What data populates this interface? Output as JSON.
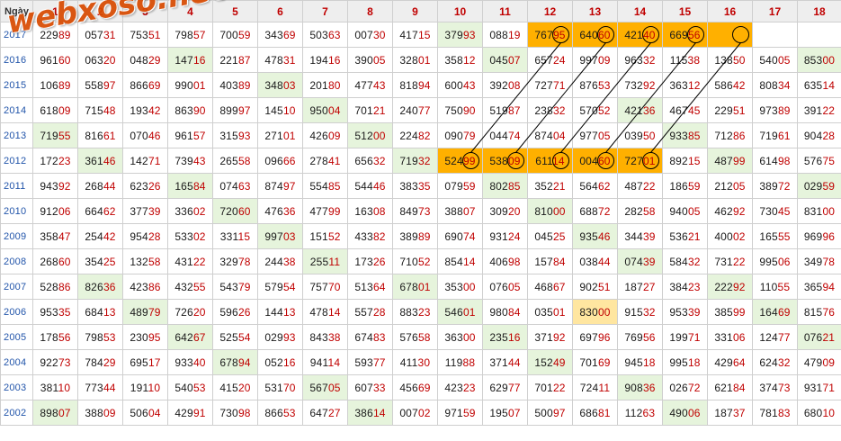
{
  "header": {
    "corner_label": "Ngày",
    "days": [
      "1",
      "2",
      "3",
      "4",
      "5",
      "6",
      "7",
      "8",
      "9",
      "10",
      "11",
      "12",
      "13",
      "14",
      "15",
      "16",
      "17",
      "18"
    ]
  },
  "logo": {
    "text": "webxoso.net"
  },
  "rows": [
    {
      "year": "2017",
      "cells": [
        "22989",
        "05731",
        "75351",
        "79857",
        "70059",
        "34369",
        "50363",
        "00730",
        "41715",
        "37993",
        "08819",
        "76795",
        "64060",
        "42140",
        "66956",
        "",
        "",
        ""
      ],
      "green": [
        9
      ],
      "orange": [
        11,
        12,
        13,
        14,
        15
      ],
      "yellow": []
    },
    {
      "year": "2016",
      "cells": [
        "96160",
        "06320",
        "04829",
        "14716",
        "22187",
        "47831",
        "19416",
        "39005",
        "32801",
        "35812",
        "04507",
        "65724",
        "99709",
        "96332",
        "11538",
        "13850",
        "54005",
        "85300"
      ],
      "green": [
        3,
        10,
        17
      ],
      "orange": [],
      "yellow": []
    },
    {
      "year": "2015",
      "cells": [
        "10689",
        "55897",
        "86669",
        "99001",
        "40389",
        "34803",
        "20180",
        "47743",
        "81894",
        "60043",
        "39208",
        "72771",
        "87653",
        "73292",
        "36312",
        "58642",
        "80834",
        "63514"
      ],
      "green": [
        5
      ],
      "orange": [],
      "yellow": []
    },
    {
      "year": "2014",
      "cells": [
        "61809",
        "71548",
        "19342",
        "86390",
        "89997",
        "14510",
        "95004",
        "70121",
        "24077",
        "75090",
        "51987",
        "23832",
        "57052",
        "42136",
        "46745",
        "22951",
        "97389",
        "39122"
      ],
      "green": [
        6,
        13
      ],
      "orange": [],
      "yellow": []
    },
    {
      "year": "2013",
      "cells": [
        "71955",
        "81661",
        "07046",
        "96157",
        "31593",
        "27101",
        "42609",
        "51200",
        "22482",
        "09079",
        "04474",
        "87404",
        "97705",
        "03950",
        "93385",
        "71286",
        "71961",
        "90428"
      ],
      "green": [
        0,
        7,
        14
      ],
      "orange": [],
      "yellow": []
    },
    {
      "year": "2012",
      "cells": [
        "17223",
        "36146",
        "14271",
        "73943",
        "26558",
        "09666",
        "27841",
        "65632",
        "71932",
        "52499",
        "53809",
        "61114",
        "00460",
        "72701",
        "89215",
        "48799",
        "61498",
        "57675"
      ],
      "green": [
        1,
        8,
        15
      ],
      "orange": [
        9,
        10,
        11,
        12,
        13
      ],
      "yellow": []
    },
    {
      "year": "2011",
      "cells": [
        "94392",
        "26844",
        "62326",
        "16584",
        "07463",
        "87497",
        "55485",
        "54446",
        "38335",
        "07959",
        "80285",
        "35221",
        "56462",
        "48722",
        "18659",
        "21205",
        "38972",
        "02959"
      ],
      "green": [
        3,
        10,
        17
      ],
      "orange": [],
      "yellow": []
    },
    {
      "year": "2010",
      "cells": [
        "91206",
        "66462",
        "37739",
        "33602",
        "72060",
        "47636",
        "47799",
        "16308",
        "84973",
        "38807",
        "30920",
        "81000",
        "68872",
        "28258",
        "94005",
        "46292",
        "73045",
        "83100"
      ],
      "green": [
        4,
        11
      ],
      "orange": [],
      "yellow": []
    },
    {
      "year": "2009",
      "cells": [
        "35847",
        "25442",
        "95428",
        "53302",
        "33115",
        "99703",
        "15152",
        "43382",
        "38989",
        "69074",
        "93124",
        "04525",
        "93546",
        "34439",
        "53621",
        "40002",
        "16555",
        "96996"
      ],
      "green": [
        5,
        12
      ],
      "orange": [],
      "yellow": []
    },
    {
      "year": "2008",
      "cells": [
        "26860",
        "35425",
        "13258",
        "43122",
        "32978",
        "24438",
        "25511",
        "17326",
        "71052",
        "85414",
        "40698",
        "15784",
        "03844",
        "07439",
        "58432",
        "73122",
        "99506",
        "34978"
      ],
      "green": [
        6,
        13
      ],
      "orange": [],
      "yellow": []
    },
    {
      "year": "2007",
      "cells": [
        "52886",
        "82636",
        "42386",
        "43255",
        "54379",
        "57954",
        "75770",
        "51364",
        "67801",
        "35300",
        "07605",
        "46867",
        "90251",
        "18727",
        "38423",
        "22292",
        "11055",
        "36594"
      ],
      "green": [
        1,
        8,
        15
      ],
      "orange": [],
      "yellow": []
    },
    {
      "year": "2006",
      "cells": [
        "95335",
        "68413",
        "48979",
        "72620",
        "59626",
        "14413",
        "47814",
        "55728",
        "88323",
        "54601",
        "98084",
        "03501",
        "83000",
        "91532",
        "95339",
        "38599",
        "16469",
        "81576"
      ],
      "green": [
        2,
        9,
        16
      ],
      "orange": [],
      "yellow": [
        12
      ]
    },
    {
      "year": "2005",
      "cells": [
        "17856",
        "79853",
        "23095",
        "64267",
        "52554",
        "02993",
        "84338",
        "67483",
        "57658",
        "36300",
        "23516",
        "37192",
        "69796",
        "76956",
        "19971",
        "33106",
        "12477",
        "07621"
      ],
      "green": [
        3,
        10,
        17
      ],
      "orange": [],
      "yellow": []
    },
    {
      "year": "2004",
      "cells": [
        "92273",
        "78429",
        "69517",
        "93340",
        "67894",
        "05216",
        "94114",
        "59377",
        "41130",
        "11988",
        "37144",
        "15249",
        "70169",
        "94518",
        "99518",
        "42964",
        "62432",
        "47909"
      ],
      "green": [
        4,
        11
      ],
      "orange": [],
      "yellow": []
    },
    {
      "year": "2003",
      "cells": [
        "38110",
        "77344",
        "19110",
        "54053",
        "41520",
        "53170",
        "56705",
        "60733",
        "45669",
        "42323",
        "62977",
        "70122",
        "72411",
        "90836",
        "02672",
        "62184",
        "37473",
        "93171"
      ],
      "green": [
        6,
        13
      ],
      "orange": [],
      "yellow": []
    },
    {
      "year": "2002",
      "cells": [
        "89807",
        "38809",
        "50604",
        "42991",
        "73098",
        "86653",
        "64727",
        "38614",
        "00702",
        "97159",
        "19507",
        "50097",
        "68681",
        "11263",
        "49006",
        "18737",
        "78183",
        "68010"
      ],
      "green": [
        0,
        7,
        14
      ],
      "orange": [],
      "yellow": []
    }
  ],
  "colors": {
    "green_cell": "#e6f4dc",
    "orange_cell": "#ffb000",
    "yellow_cell": "#ffe6a0",
    "tail_digits": "#c00000",
    "year_text": "#2255aa"
  },
  "links": [
    {
      "from_row": 5,
      "from_col": 9,
      "to_row": 0,
      "to_col": 11
    },
    {
      "from_row": 5,
      "from_col": 10,
      "to_row": 0,
      "to_col": 12
    },
    {
      "from_row": 5,
      "from_col": 11,
      "to_row": 0,
      "to_col": 13
    },
    {
      "from_row": 5,
      "from_col": 12,
      "to_row": 0,
      "to_col": 14
    },
    {
      "from_row": 5,
      "from_col": 13,
      "to_row": 0,
      "to_col": 15
    }
  ]
}
